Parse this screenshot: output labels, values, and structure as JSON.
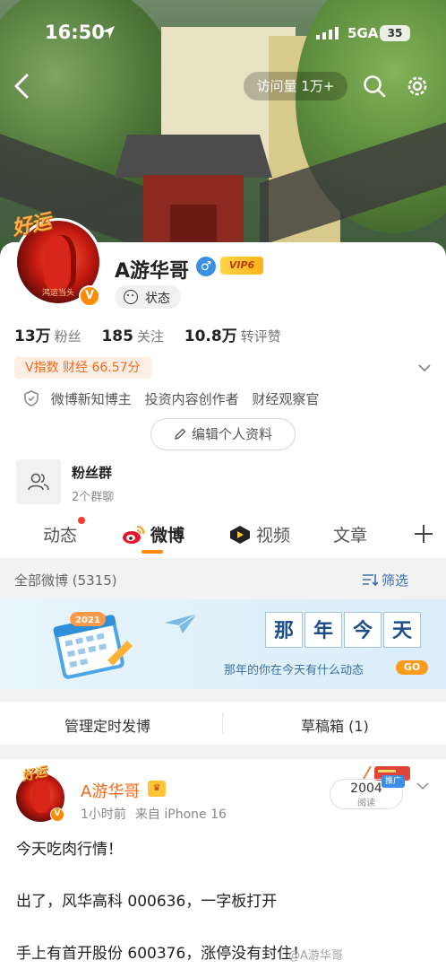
{
  "status_bar": {
    "time": "16:50",
    "network": "5GA",
    "battery": "35"
  },
  "header": {
    "visit_label": "访问量 1万+"
  },
  "profile": {
    "avatar_badge": "好运",
    "avatar_caption": "鸿运当头",
    "name": "A游华哥",
    "vip_label": "VIP6",
    "status_label": "状态",
    "stats": [
      {
        "value": "13万",
        "label": "粉丝"
      },
      {
        "value": "185",
        "label": "关注"
      },
      {
        "value": "10.8万",
        "label": "转评赞"
      }
    ],
    "vindex": "V指数 财经 66.57分",
    "tags": [
      "微博新知博主",
      "投资内容创作者",
      "财经观察官"
    ],
    "edit_label": "编辑个人资料",
    "fans_group": {
      "title": "粉丝群",
      "sub": "2个群聊"
    }
  },
  "tabs": [
    {
      "label": "动态",
      "active": false
    },
    {
      "label": "微博",
      "active": true
    },
    {
      "label": "视频",
      "active": false
    },
    {
      "label": "文章",
      "active": false
    }
  ],
  "filter_bar": {
    "all_label": "全部微博 (5315)",
    "filter_label": "筛选"
  },
  "banner": {
    "calendar_year": "2021",
    "title_chars": [
      "那",
      "年",
      "今",
      "天"
    ],
    "subtitle": "那年的你在今天有什么动态",
    "go_label": "GO"
  },
  "actions": {
    "schedule_label": "管理定时发博",
    "drafts_label": "草稿箱 (1)"
  },
  "post": {
    "badge": "好运",
    "author": "A游华哥",
    "time": "1小时前",
    "source": "来自 iPhone 16",
    "reads_count": "2004",
    "reads_label": "阅读",
    "promo_label": "推广",
    "lines": [
      "今天吃肉行情！",
      "出了，风华高科 000636，一字板打开",
      "手上有首开股份 600376，涨停没有封住！"
    ],
    "watermark": "@A游华哥"
  },
  "colors": {
    "accent": "#ff8a00",
    "link": "#3a6fb0",
    "orange_text": "#f06a1a"
  }
}
